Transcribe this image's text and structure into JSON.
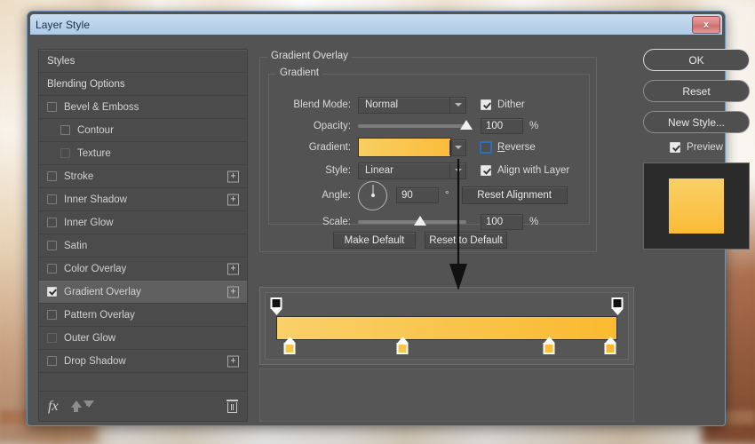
{
  "window": {
    "title": "Layer Style",
    "close_label": "x",
    "close_icon": "close-icon"
  },
  "styles_panel": {
    "items": [
      {
        "label": "Styles",
        "type": "header",
        "checkbox": "none",
        "plus": false,
        "selected": false,
        "indent": false
      },
      {
        "label": "Blending Options",
        "type": "header",
        "checkbox": "none",
        "plus": false,
        "selected": false,
        "indent": false
      },
      {
        "label": "Bevel & Emboss",
        "type": "effect",
        "checkbox": "unchecked",
        "plus": false,
        "selected": false,
        "indent": false
      },
      {
        "label": "Contour",
        "type": "effect",
        "checkbox": "unchecked",
        "plus": false,
        "selected": false,
        "indent": true
      },
      {
        "label": "Texture",
        "type": "effect",
        "checkbox": "disabled",
        "plus": false,
        "selected": false,
        "indent": true
      },
      {
        "label": "Stroke",
        "type": "effect",
        "checkbox": "unchecked",
        "plus": true,
        "selected": false,
        "indent": false
      },
      {
        "label": "Inner Shadow",
        "type": "effect",
        "checkbox": "unchecked",
        "plus": true,
        "selected": false,
        "indent": false
      },
      {
        "label": "Inner Glow",
        "type": "effect",
        "checkbox": "unchecked",
        "plus": false,
        "selected": false,
        "indent": false
      },
      {
        "label": "Satin",
        "type": "effect",
        "checkbox": "unchecked",
        "plus": false,
        "selected": false,
        "indent": false
      },
      {
        "label": "Color Overlay",
        "type": "effect",
        "checkbox": "unchecked",
        "plus": true,
        "selected": false,
        "indent": false
      },
      {
        "label": "Gradient Overlay",
        "type": "effect",
        "checkbox": "checked",
        "plus": true,
        "selected": true,
        "indent": false
      },
      {
        "label": "Pattern Overlay",
        "type": "effect",
        "checkbox": "unchecked",
        "plus": false,
        "selected": false,
        "indent": false
      },
      {
        "label": "Outer Glow",
        "type": "effect",
        "checkbox": "disabled",
        "plus": false,
        "selected": false,
        "indent": false
      },
      {
        "label": "Drop Shadow",
        "type": "effect",
        "checkbox": "unchecked",
        "plus": true,
        "selected": false,
        "indent": false
      }
    ],
    "footer": {
      "fx_label": "fx",
      "fx_icon": "fx-icon",
      "move_up_icon": "arrow-up-icon",
      "move_down_icon": "arrow-down-icon",
      "delete_icon": "trash-icon"
    }
  },
  "gradient_overlay": {
    "section_title": "Gradient Overlay",
    "group_title": "Gradient",
    "blend_mode": {
      "label": "Blend Mode:",
      "value": "Normal"
    },
    "dither": {
      "label": "Dither",
      "checked": true
    },
    "opacity": {
      "label": "Opacity:",
      "value": "100",
      "unit": "%",
      "slider_percent": 100
    },
    "gradient": {
      "label": "Gradient:",
      "swatch_from": "#f8cf62",
      "swatch_to": "#fbbb3c"
    },
    "reverse": {
      "label": "Reverse",
      "checked": false,
      "focused": true
    },
    "style": {
      "label": "Style:",
      "value": "Linear"
    },
    "align_with_layer": {
      "label": "Align with Layer",
      "checked": true
    },
    "angle": {
      "label": "Angle:",
      "value": "90",
      "unit": "°",
      "dial_icon": "angle-dial-icon"
    },
    "reset_alignment": {
      "label": "Reset Alignment"
    },
    "scale": {
      "label": "Scale:",
      "value": "100",
      "unit": "%",
      "slider_percent": 57
    },
    "make_default": {
      "label": "Make Default"
    },
    "reset_to_default": {
      "label": "Reset to Default"
    }
  },
  "gradient_editor": {
    "bar_from": "#f9d06a",
    "bar_to": "#fbb92f",
    "opacity_stops": [
      {
        "position": 0,
        "color": "#111111"
      },
      {
        "position": 100,
        "color": "#111111"
      }
    ],
    "color_stops": [
      {
        "position": 4,
        "color": "#f7c64f"
      },
      {
        "position": 37,
        "color": "#f9c64b"
      },
      {
        "position": 80,
        "color": "#fbbe3a"
      },
      {
        "position": 98,
        "color": "#fbb82f"
      }
    ]
  },
  "annotation": {
    "arrow_icon": "down-arrow-annotation",
    "color": "#111111"
  },
  "buttons": {
    "ok": "OK",
    "reset": "Reset",
    "new_style": "New Style...",
    "preview": {
      "label": "Preview",
      "checked": true
    }
  },
  "preview": {
    "swatch_from": "#f9d068",
    "swatch_to": "#fbbb35",
    "backdrop_color": "#2b2b2b"
  }
}
